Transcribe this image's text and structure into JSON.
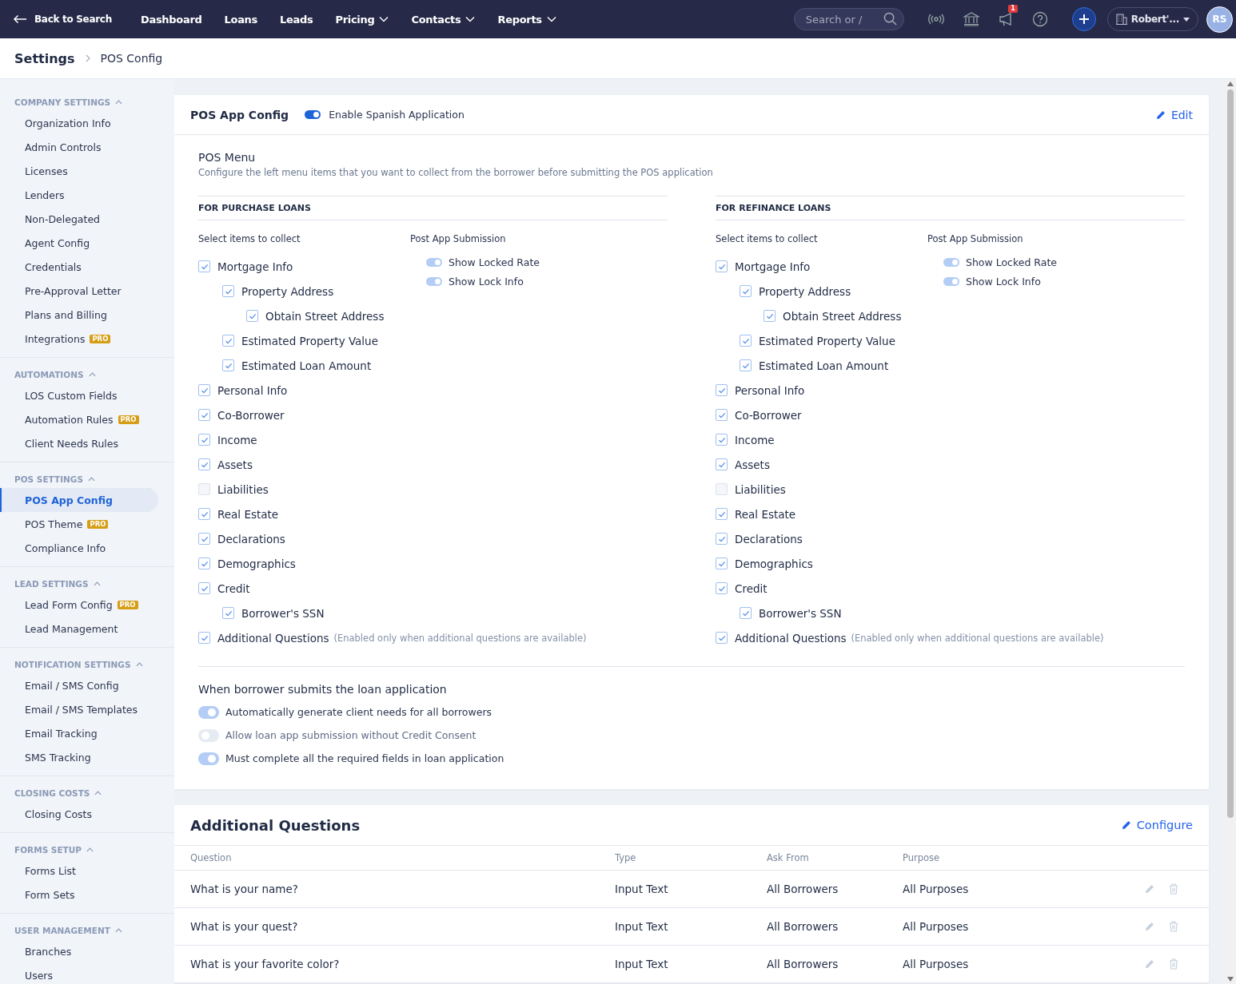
{
  "nav": {
    "back": "Back to Search",
    "items": [
      {
        "label": "Dashboard",
        "dropdown": false
      },
      {
        "label": "Loans",
        "dropdown": false
      },
      {
        "label": "Leads",
        "dropdown": false
      },
      {
        "label": "Pricing",
        "dropdown": true
      },
      {
        "label": "Contacts",
        "dropdown": true
      },
      {
        "label": "Reports",
        "dropdown": true
      }
    ],
    "search_placeholder": "Search or /",
    "notification_count": "1",
    "account": "Robert'...",
    "avatar": "RS"
  },
  "breadcrumb": [
    "Settings",
    "POS Config"
  ],
  "sidebar": [
    {
      "title": "COMPANY SETTINGS",
      "expanded": true,
      "items": [
        {
          "label": "Organization Info",
          "selected": false
        },
        {
          "label": "Admin Controls",
          "selected": false
        },
        {
          "label": "Licenses",
          "selected": false
        },
        {
          "label": "Lenders",
          "selected": false
        },
        {
          "label": "Non-Delegated",
          "selected": false
        },
        {
          "label": "Agent Config",
          "selected": false
        },
        {
          "label": "Credentials",
          "selected": false
        },
        {
          "label": "Pre-Approval Letter",
          "selected": false
        },
        {
          "label": "Plans and Billing",
          "selected": false
        },
        {
          "label": "Integrations",
          "badge": "PRO",
          "selected": false
        }
      ]
    },
    {
      "title": "AUTOMATIONS",
      "expanded": true,
      "items": [
        {
          "label": "LOS Custom Fields",
          "selected": false
        },
        {
          "label": "Automation Rules",
          "badge": "PRO",
          "selected": false
        },
        {
          "label": "Client Needs Rules",
          "selected": false
        }
      ]
    },
    {
      "title": "POS SETTINGS",
      "expanded": true,
      "items": [
        {
          "label": "POS App Config",
          "selected": true
        },
        {
          "label": "POS Theme",
          "badge": "PRO",
          "selected": false
        },
        {
          "label": "Compliance Info",
          "selected": false
        }
      ]
    },
    {
      "title": "LEAD SETTINGS",
      "expanded": true,
      "items": [
        {
          "label": "Lead Form Config",
          "badge": "PRO",
          "selected": false
        },
        {
          "label": "Lead Management",
          "selected": false
        }
      ]
    },
    {
      "title": "NOTIFICATION SETTINGS",
      "expanded": true,
      "items": [
        {
          "label": "Email / SMS Config",
          "selected": false
        },
        {
          "label": "Email / SMS Templates",
          "selected": false
        },
        {
          "label": "Email Tracking",
          "selected": false
        },
        {
          "label": "SMS Tracking",
          "selected": false
        }
      ]
    },
    {
      "title": "CLOSING COSTS",
      "expanded": true,
      "items": [
        {
          "label": "Closing Costs",
          "selected": false
        }
      ]
    },
    {
      "title": "FORMS SETUP",
      "expanded": true,
      "items": [
        {
          "label": "Forms List",
          "selected": false
        },
        {
          "label": "Form Sets",
          "selected": false
        }
      ]
    },
    {
      "title": "USER MANAGEMENT",
      "expanded": true,
      "items": [
        {
          "label": "Branches",
          "selected": false
        },
        {
          "label": "Users",
          "selected": false
        }
      ]
    }
  ],
  "config": {
    "title": "POS App Config",
    "spanish_toggle": {
      "label": "Enable Spanish Application",
      "on": true,
      "disabled": false
    },
    "edit": "Edit",
    "menu_title": "POS Menu",
    "menu_description": "Configure the left menu items that you want to collect from the borrower before submitting the POS application",
    "columns": [
      {
        "heading": "FOR PURCHASE LOANS",
        "collect_label": "Select items to collect",
        "post_label": "Post App Submission",
        "post_toggles": [
          {
            "label": "Show Locked Rate",
            "on": true,
            "disabled": true
          },
          {
            "label": "Show Lock Info",
            "on": true,
            "disabled": true
          }
        ],
        "items": [
          {
            "label": "Mortgage Info",
            "checked": true,
            "children": [
              {
                "label": "Property Address",
                "checked": true,
                "children": [
                  {
                    "label": "Obtain Street Address",
                    "checked": true
                  }
                ]
              },
              {
                "label": "Estimated Property Value",
                "checked": true
              },
              {
                "label": "Estimated Loan Amount",
                "checked": true
              }
            ]
          },
          {
            "label": "Personal Info",
            "checked": true
          },
          {
            "label": "Co-Borrower",
            "checked": true
          },
          {
            "label": "Income",
            "checked": true
          },
          {
            "label": "Assets",
            "checked": true
          },
          {
            "label": "Liabilities",
            "checked": false
          },
          {
            "label": "Real Estate",
            "checked": true
          },
          {
            "label": "Declarations",
            "checked": true
          },
          {
            "label": "Demographics",
            "checked": true
          },
          {
            "label": "Credit",
            "checked": true,
            "children": [
              {
                "label": "Borrower's SSN",
                "checked": true
              }
            ]
          },
          {
            "label": "Additional Questions",
            "note": "(Enabled only when additional questions are available)",
            "checked": true
          }
        ]
      },
      {
        "heading": "FOR REFINANCE LOANS",
        "collect_label": "Select items to collect",
        "post_label": "Post App Submission",
        "post_toggles": [
          {
            "label": "Show Locked Rate",
            "on": true,
            "disabled": true
          },
          {
            "label": "Show Lock Info",
            "on": true,
            "disabled": true
          }
        ],
        "items": [
          {
            "label": "Mortgage Info",
            "checked": true,
            "children": [
              {
                "label": "Property Address",
                "checked": true,
                "children": [
                  {
                    "label": "Obtain Street Address",
                    "checked": true
                  }
                ]
              },
              {
                "label": "Estimated Property Value",
                "checked": true
              },
              {
                "label": "Estimated Loan Amount",
                "checked": true
              }
            ]
          },
          {
            "label": "Personal Info",
            "checked": true
          },
          {
            "label": "Co-Borrower",
            "checked": true
          },
          {
            "label": "Income",
            "checked": true
          },
          {
            "label": "Assets",
            "checked": true
          },
          {
            "label": "Liabilities",
            "checked": false
          },
          {
            "label": "Real Estate",
            "checked": true
          },
          {
            "label": "Declarations",
            "checked": true
          },
          {
            "label": "Demographics",
            "checked": true
          },
          {
            "label": "Credit",
            "checked": true,
            "children": [
              {
                "label": "Borrower's SSN",
                "checked": true
              }
            ]
          },
          {
            "label": "Additional Questions",
            "note": "(Enabled only when additional questions are available)",
            "checked": true
          }
        ]
      }
    ],
    "submission_title": "When borrower submits the loan application",
    "submission_toggles": [
      {
        "label": "Automatically generate client needs for all borrowers",
        "on": true,
        "disabled": true
      },
      {
        "label": "Allow loan app submission without Credit Consent",
        "on": false,
        "disabled": true
      },
      {
        "label": "Must complete all the required fields in loan application",
        "on": true,
        "disabled": true
      }
    ]
  },
  "questions": {
    "title": "Additional Questions",
    "action": "Configure",
    "columns": [
      "Question",
      "Type",
      "Ask From",
      "Purpose"
    ],
    "rows": [
      [
        "What is your name?",
        "Input Text",
        "All Borrowers",
        "All Purposes"
      ],
      [
        "What is your quest?",
        "Input Text",
        "All Borrowers",
        "All Purposes"
      ],
      [
        "What is your favorite color?",
        "Input Text",
        "All Borrowers",
        "All Purposes"
      ]
    ]
  }
}
